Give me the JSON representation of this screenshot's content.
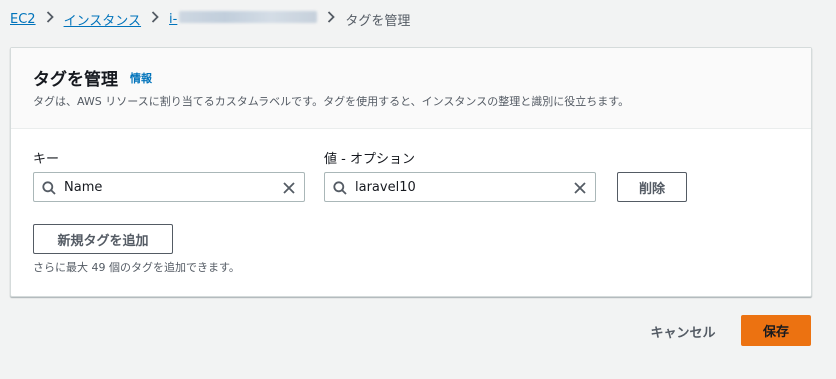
{
  "breadcrumb": {
    "items": [
      "EC2",
      "インスタンス",
      "i-"
    ],
    "current": "タグを管理"
  },
  "panel": {
    "title": "タグを管理",
    "info_link": "情報",
    "description": "タグは、AWS リソースに割り当てるカスタムラベルです。タグを使用すると、インスタンスの整理と識別に役立ちます。"
  },
  "tag_row": {
    "key_label": "キー",
    "key_value": "Name",
    "value_label": "値 - オプション",
    "value_value": "laravel10",
    "remove_label": "削除"
  },
  "add_tag": {
    "label": "新規タグを追加",
    "limit_note": "さらに最大 49 個のタグを追加できます。"
  },
  "footer": {
    "cancel_label": "キャンセル",
    "save_label": "保存"
  },
  "colors": {
    "link": "#0073bb",
    "primary": "#ec7211",
    "background": "#f2f3f3"
  },
  "icons": {
    "search": "search-icon",
    "clear": "close-icon",
    "separator": "chevron-right-icon"
  }
}
